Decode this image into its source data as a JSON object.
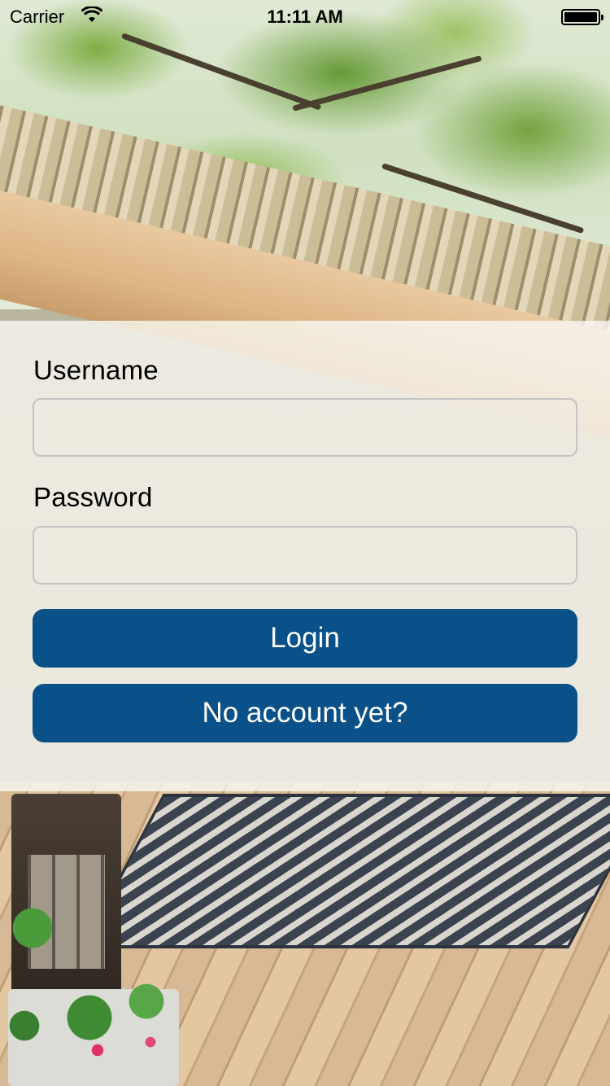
{
  "status_bar": {
    "carrier": "Carrier",
    "wifi_icon": "wifi-icon",
    "time": "11:11 AM",
    "battery_icon": "battery-icon"
  },
  "login_form": {
    "username_label": "Username",
    "username_value": "",
    "username_placeholder": "",
    "password_label": "Password",
    "password_value": "",
    "password_placeholder": "",
    "login_button": "Login",
    "signup_button": "No account yet?"
  },
  "colors": {
    "button_background": "#0a5189",
    "button_text": "#ffffff",
    "panel_background": "rgba(248,246,240,0.82)",
    "field_border": "#c4c4c4"
  }
}
